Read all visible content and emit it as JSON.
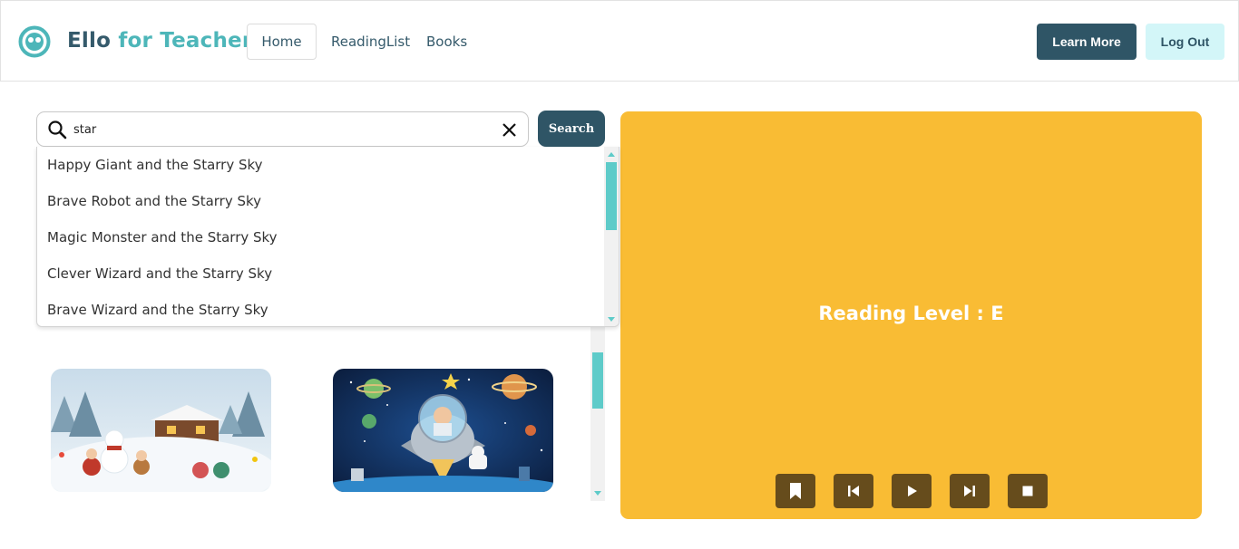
{
  "header": {
    "brand_part1": "Ello",
    "brand_part2": "for Teachers",
    "nav": {
      "home": "Home",
      "reading_list": "ReadingList",
      "books": "Books"
    },
    "learn_more": "Learn More",
    "log_out": "Log Out"
  },
  "search": {
    "value": "star",
    "button": "Search",
    "suggestions": [
      "Happy Giant and the Starry Sky",
      "Brave Robot and the Starry Sky",
      "Magic Monster and the Starry Sky",
      "Clever Wizard and the Starry Sky",
      "Brave Wizard and the Starry Sky"
    ]
  },
  "books": [
    {
      "image": "winter-snowman-scene"
    },
    {
      "image": "astronaut-rocket-space-scene"
    }
  ],
  "reader": {
    "level_text": "Reading Level : E",
    "controls": [
      "bookmark-icon",
      "previous-icon",
      "play-icon",
      "next-icon",
      "stop-icon"
    ]
  },
  "colors": {
    "primary": "#2f5566",
    "accent_teal": "#4db6b9",
    "logout_bg": "#d3f6f8",
    "reader_bg": "#f9bc34",
    "control_bg": "#664c1c",
    "scrollbar_thumb": "#5ecbc9"
  }
}
